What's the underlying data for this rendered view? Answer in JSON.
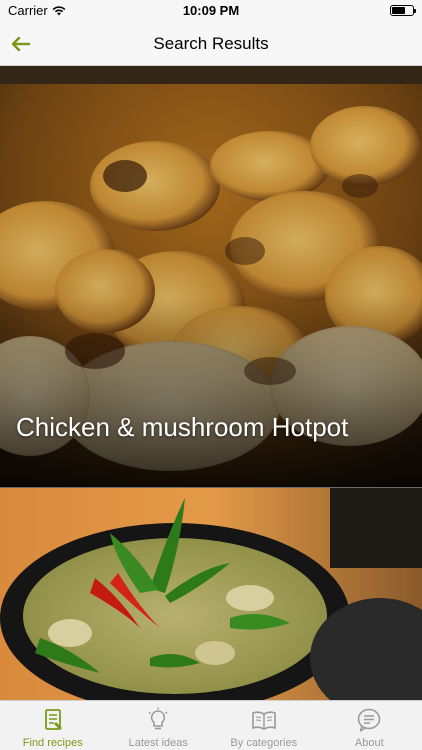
{
  "status_bar": {
    "carrier": "Carrier",
    "time": "10:09 PM"
  },
  "nav": {
    "title": "Search Results",
    "back_icon": "back-arrow-icon"
  },
  "recipes": [
    {
      "title": "Chicken & mushroom Hotpot"
    },
    {
      "title": ""
    }
  ],
  "tabs": [
    {
      "label": "Find recipes",
      "icon": "recipe-book-icon",
      "active": true
    },
    {
      "label": "Latest ideas",
      "icon": "lightbulb-icon",
      "active": false
    },
    {
      "label": "By categories",
      "icon": "open-book-icon",
      "active": false
    },
    {
      "label": "About",
      "icon": "chat-bubble-icon",
      "active": false
    }
  ],
  "colors": {
    "accent": "#7a9a1a",
    "inactive_tab": "#9a9a9a",
    "bar_background": "#f7f7f7"
  }
}
